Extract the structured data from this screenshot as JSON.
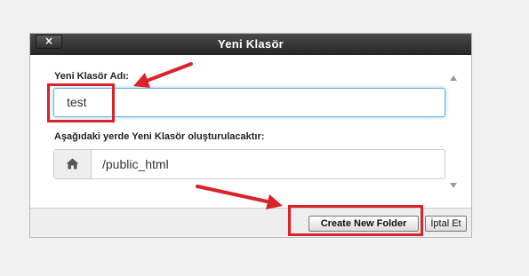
{
  "dialog": {
    "title": "Yeni Klasör",
    "close_label": "×",
    "name_label": "Yeni Klasör Adı:",
    "name_value": "test",
    "location_label": "Aşağıdaki yerde Yeni Klasör oluşturulacaktır:",
    "location_value": "/public_html",
    "location_icon": "home-icon",
    "create_label": "Create New Folder",
    "cancel_label": "İptal Et"
  },
  "annotations": {
    "highlight_color": "#d9232a",
    "accent_color": "#66afe9"
  }
}
